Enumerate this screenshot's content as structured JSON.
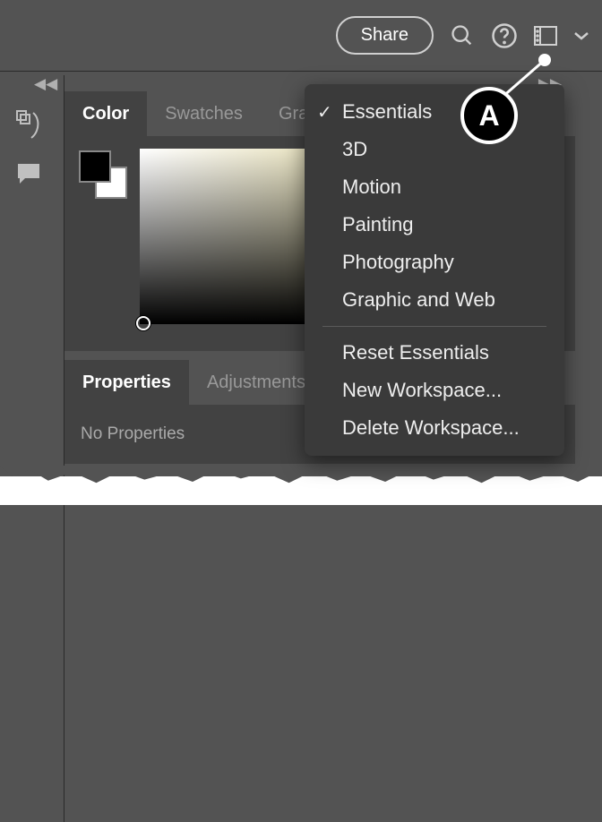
{
  "topbar": {
    "share_label": "Share"
  },
  "panels": {
    "color": {
      "tabs": [
        "Color",
        "Swatches",
        "Gradients"
      ],
      "active_tab": 0
    },
    "properties": {
      "tabs": [
        "Properties",
        "Adjustments"
      ],
      "active_tab": 0,
      "empty_text": "No Properties"
    }
  },
  "workspace_menu": {
    "selected": "Essentials",
    "items": [
      "Essentials",
      "3D",
      "Motion",
      "Painting",
      "Photography",
      "Graphic and Web"
    ],
    "actions": [
      "Reset Essentials",
      "New Workspace...",
      "Delete Workspace..."
    ]
  },
  "callout": {
    "label": "A"
  }
}
